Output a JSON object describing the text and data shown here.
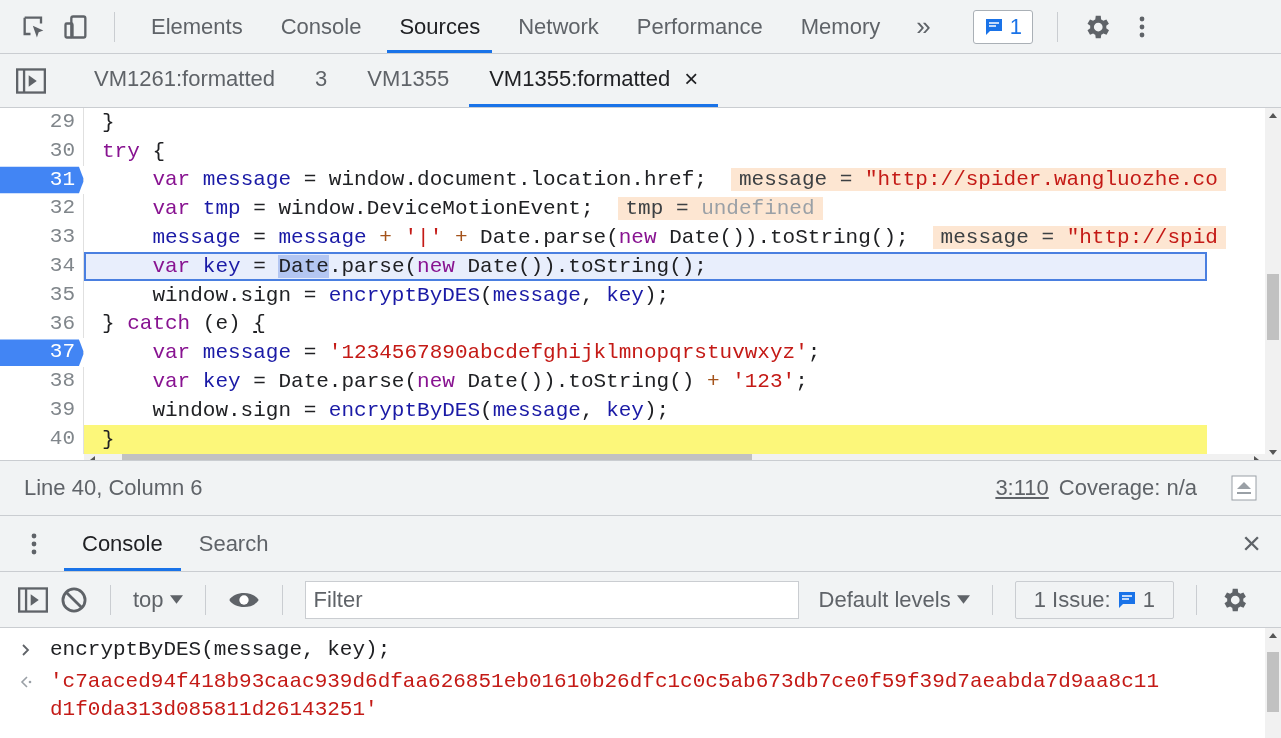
{
  "main_tabs": [
    {
      "label": "Elements",
      "selected": false
    },
    {
      "label": "Console",
      "selected": false
    },
    {
      "label": "Sources",
      "selected": true
    },
    {
      "label": "Network",
      "selected": false
    },
    {
      "label": "Performance",
      "selected": false
    },
    {
      "label": "Memory",
      "selected": false
    }
  ],
  "more_tabs": "»",
  "issues_badge": "1",
  "file_tabs": [
    {
      "label": "VM1261:formatted",
      "selected": false
    },
    {
      "label": "3",
      "selected": false
    },
    {
      "label": "VM1355",
      "selected": false
    },
    {
      "label": "VM1355:formatted",
      "selected": true,
      "close": "×"
    }
  ],
  "code_lines": [
    {
      "number": "29",
      "breakpoint": false,
      "indented": false,
      "active": false,
      "highlighted": false,
      "tokens": [
        {
          "kind": "plain",
          "t": "}"
        }
      ]
    },
    {
      "number": "30",
      "breakpoint": false,
      "indented": false,
      "active": false,
      "highlighted": false,
      "tokens": [
        {
          "kind": "keyword",
          "t": "try"
        },
        {
          "kind": "plain",
          "t": " {"
        }
      ]
    },
    {
      "number": "31",
      "breakpoint": true,
      "indented": true,
      "active": false,
      "highlighted": false,
      "tokens": [
        {
          "kind": "keyword",
          "t": "var"
        },
        {
          "kind": "variable",
          "t": " message"
        },
        {
          "kind": "plain",
          "t": " = window.document.location.href;"
        }
      ],
      "inline_value": {
        "name": "message = ",
        "value": "\"http://spider.wangluozhe.co",
        "kind": "string"
      }
    },
    {
      "number": "32",
      "breakpoint": false,
      "indented": true,
      "active": false,
      "highlighted": false,
      "tokens": [
        {
          "kind": "keyword",
          "t": "var"
        },
        {
          "kind": "variable",
          "t": " tmp"
        },
        {
          "kind": "plain",
          "t": " = window.DeviceMotionEvent;"
        }
      ],
      "inline_value": {
        "name": "tmp = ",
        "value": "undefined",
        "kind": "undefined"
      }
    },
    {
      "number": "33",
      "breakpoint": false,
      "indented": true,
      "active": false,
      "highlighted": false,
      "tokens": [
        {
          "kind": "variable",
          "t": "message"
        },
        {
          "kind": "plain",
          "t": " = "
        },
        {
          "kind": "variable",
          "t": "message"
        },
        {
          "kind": "operator",
          "t": " +"
        },
        {
          "kind": "string",
          "t": " '|'"
        },
        {
          "kind": "operator",
          "t": " +"
        },
        {
          "kind": "plain",
          "t": " Date.parse("
        },
        {
          "kind": "keyword",
          "t": "new"
        },
        {
          "kind": "plain",
          "t": " Date()).toString();"
        }
      ],
      "inline_value": {
        "name": "message = ",
        "value": "\"http://spid",
        "kind": "string"
      }
    },
    {
      "number": "34",
      "breakpoint": false,
      "indented": true,
      "active": true,
      "highlighted": false,
      "tokens": [
        {
          "kind": "keyword",
          "t": "var"
        },
        {
          "kind": "variable",
          "t": " key"
        },
        {
          "kind": "plain",
          "t": " = "
        },
        {
          "kind": "selection",
          "t": "Date"
        },
        {
          "kind": "plain",
          "t": ".parse("
        },
        {
          "kind": "keyword",
          "t": "new"
        },
        {
          "kind": "plain",
          "t": " Date()).toString();"
        }
      ]
    },
    {
      "number": "35",
      "breakpoint": false,
      "indented": true,
      "active": false,
      "highlighted": false,
      "tokens": [
        {
          "kind": "plain",
          "t": "window.sign = "
        },
        {
          "kind": "variable",
          "t": "encryptByDES"
        },
        {
          "kind": "plain",
          "t": "("
        },
        {
          "kind": "variable",
          "t": "message"
        },
        {
          "kind": "plain",
          "t": ", "
        },
        {
          "kind": "variable",
          "t": "key"
        },
        {
          "kind": "plain",
          "t": ");"
        }
      ]
    },
    {
      "number": "36",
      "breakpoint": false,
      "indented": false,
      "active": false,
      "highlighted": false,
      "tokens": [
        {
          "kind": "plain",
          "t": "}"
        },
        {
          "kind": "keyword",
          "t": " catch"
        },
        {
          "kind": "plain",
          "t": " (e) "
        },
        {
          "kind": "bracket_match",
          "t": "{"
        }
      ]
    },
    {
      "number": "37",
      "breakpoint": true,
      "indented": true,
      "active": false,
      "highlighted": false,
      "tokens": [
        {
          "kind": "keyword",
          "t": "var"
        },
        {
          "kind": "variable",
          "t": " message"
        },
        {
          "kind": "plain",
          "t": " = "
        },
        {
          "kind": "string",
          "t": "'1234567890abcdefghijklmnopqrstuvwxyz'"
        },
        {
          "kind": "plain",
          "t": ";"
        }
      ]
    },
    {
      "number": "38",
      "breakpoint": false,
      "indented": true,
      "active": false,
      "highlighted": false,
      "tokens": [
        {
          "kind": "keyword",
          "t": "var"
        },
        {
          "kind": "variable",
          "t": " key"
        },
        {
          "kind": "plain",
          "t": " = Date.parse("
        },
        {
          "kind": "keyword",
          "t": "new"
        },
        {
          "kind": "plain",
          "t": " Date()).toString()"
        },
        {
          "kind": "operator",
          "t": " +"
        },
        {
          "kind": "string",
          "t": " '123'"
        },
        {
          "kind": "plain",
          "t": ";"
        }
      ]
    },
    {
      "number": "39",
      "breakpoint": false,
      "indented": true,
      "active": false,
      "highlighted": false,
      "tokens": [
        {
          "kind": "plain",
          "t": "window.sign = "
        },
        {
          "kind": "variable",
          "t": "encryptByDES"
        },
        {
          "kind": "plain",
          "t": "("
        },
        {
          "kind": "variable",
          "t": "message"
        },
        {
          "kind": "plain",
          "t": ", "
        },
        {
          "kind": "variable",
          "t": "key"
        },
        {
          "kind": "plain",
          "t": ");"
        }
      ]
    },
    {
      "number": "40",
      "breakpoint": false,
      "indented": false,
      "active": false,
      "highlighted": true,
      "tokens": [
        {
          "kind": "plain",
          "t": "}"
        }
      ]
    }
  ],
  "status_bar": {
    "position": "Line 40, Column 6",
    "link": "3:110",
    "coverage": "Coverage: n/a"
  },
  "drawer_tabs": [
    {
      "label": "Console",
      "selected": true
    },
    {
      "label": "Search",
      "selected": false
    }
  ],
  "drawer_close": "×",
  "console_toolbar": {
    "context": "top",
    "filter": {
      "placeholder": "Filter"
    },
    "levels": "Default levels",
    "issues_label": "1 Issue:",
    "issues_count": "1"
  },
  "console_entries": [
    {
      "kind": "input",
      "text": "encryptByDES(message, key);"
    },
    {
      "kind": "result",
      "text": "'c7aaced94f418b93caac939d6dfaa626851eb01610b26dfc1c0c5ab673db7ce0f59f39d7aeabda7d9aa8c11d1f0da313d085811d26143251'"
    }
  ]
}
